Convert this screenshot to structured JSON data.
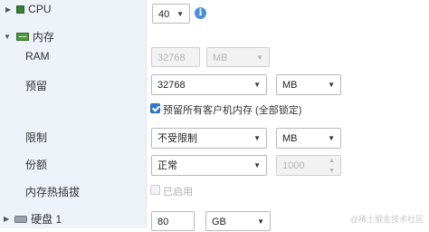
{
  "rows": {
    "cpu": {
      "label": "CPU",
      "value": "40"
    },
    "memory": {
      "label": "内存"
    },
    "ram": {
      "label": "RAM",
      "placeholder": "32768",
      "unit": "MB"
    },
    "reservation": {
      "label": "预留",
      "value": "32768",
      "unit": "MB",
      "checkbox_label": "预留所有客户机内存 (全部锁定)",
      "checkbox_checked": true
    },
    "limit": {
      "label": "限制",
      "value": "不受限制",
      "unit": "MB"
    },
    "shares": {
      "label": "份额",
      "value": "正常",
      "shares_value": "1000"
    },
    "hotplug": {
      "label": "内存热插拔",
      "checkbox_label": "已启用",
      "checkbox_checked": false
    },
    "disk": {
      "label": "硬盘 1",
      "value": "80",
      "unit": "GB"
    }
  },
  "icons": {
    "cpu": "cpu-icon",
    "memory": "memory-icon",
    "disk": "hard-disk-icon",
    "info": "info-icon"
  },
  "colors": {
    "label_column_bg": "#eef3fa",
    "accent_blue": "#2f78d0",
    "info_blue": "#4a8fd6"
  },
  "watermark": "@稀土掘金技术社区"
}
